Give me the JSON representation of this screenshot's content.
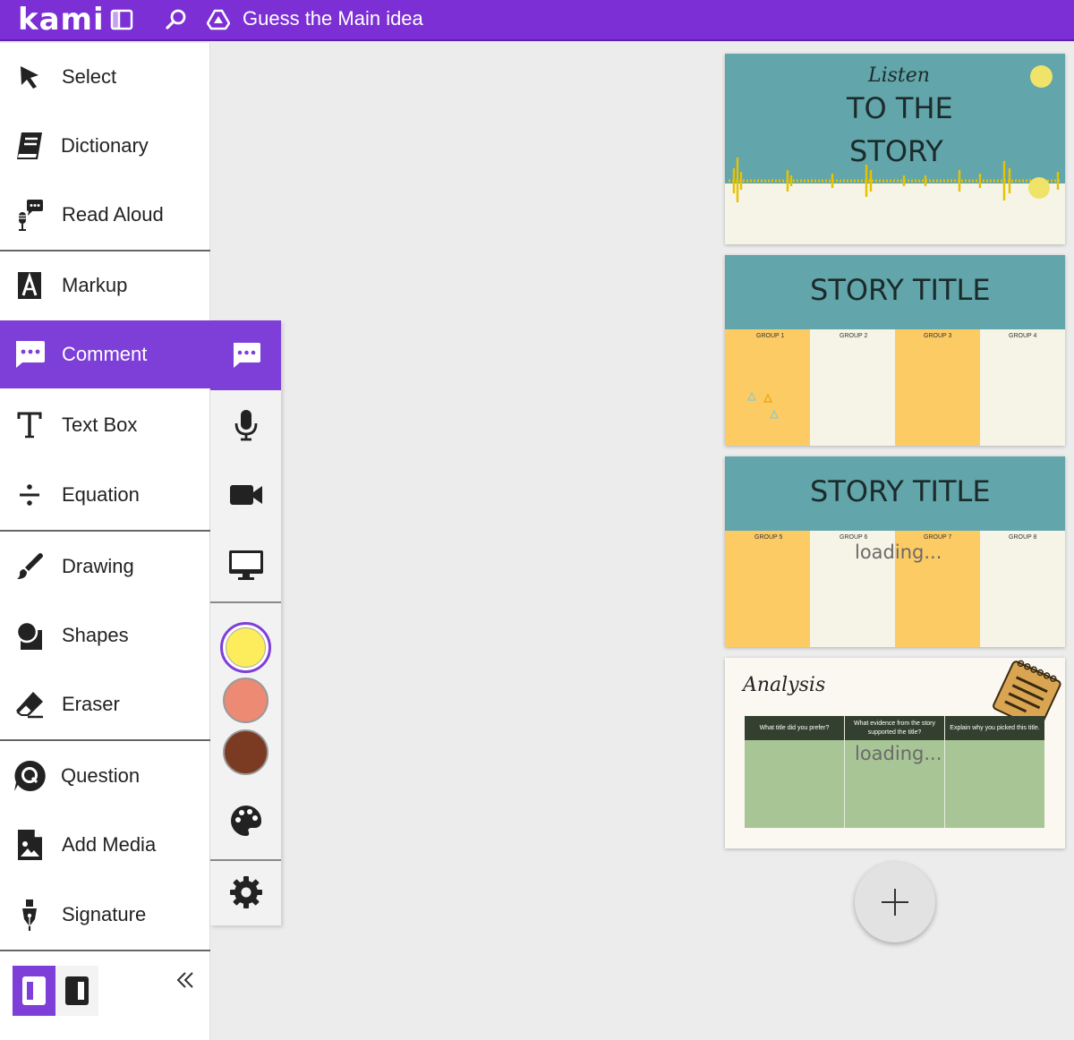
{
  "app": {
    "logo": "kami",
    "doc_title": "Guess the Main idea"
  },
  "tools": [
    {
      "label": "Select",
      "icon": "cursor-icon"
    },
    {
      "label": "Dictionary",
      "icon": "book-icon"
    },
    {
      "label": "Read Aloud",
      "icon": "read-aloud-icon"
    },
    {
      "label": "Markup",
      "icon": "markup-icon"
    },
    {
      "label": "Comment",
      "icon": "comment-icon",
      "active": true
    },
    {
      "label": "Text Box",
      "icon": "text-icon"
    },
    {
      "label": "Equation",
      "icon": "divide-icon"
    },
    {
      "label": "Drawing",
      "icon": "brush-icon"
    },
    {
      "label": "Shapes",
      "icon": "shapes-icon"
    },
    {
      "label": "Eraser",
      "icon": "eraser-icon"
    },
    {
      "label": "Question",
      "icon": "question-icon"
    },
    {
      "label": "Add Media",
      "icon": "add-media-icon"
    },
    {
      "label": "Signature",
      "icon": "pen-nib-icon"
    }
  ],
  "comment_submenu": {
    "items": [
      "text-comment-icon",
      "microphone-icon",
      "video-icon",
      "screen-icon"
    ],
    "colors": [
      "#fdec5b",
      "#ec8a74",
      "#7a3b22"
    ],
    "selected_color": "#fdec5b"
  },
  "pages": {
    "p1": {
      "script": "Listen",
      "title_line1": "TO THE",
      "title_line2": "STORY"
    },
    "p2": {
      "title": "STORY TITLE",
      "groups": [
        "GROUP 1",
        "GROUP 2",
        "GROUP 3",
        "GROUP 4"
      ]
    },
    "p3": {
      "title": "STORY TITLE",
      "groups": [
        "GROUP 5",
        "GROUP 6",
        "GROUP 7",
        "GROUP 8"
      ],
      "status": "loading..."
    },
    "p4": {
      "title": "Analysis",
      "columns": [
        "What title did you prefer?",
        "What evidence from the story supported the title?",
        "Explain why you picked this title."
      ],
      "status": "loading..."
    }
  },
  "colors": {
    "brand": "#7b2fd4",
    "active": "#7e3fd8",
    "teal": "#62a5aa",
    "mustard": "#fdcb64",
    "cream": "#f6f4e6",
    "sage": "#a8c596",
    "dark_green": "#34402f"
  }
}
